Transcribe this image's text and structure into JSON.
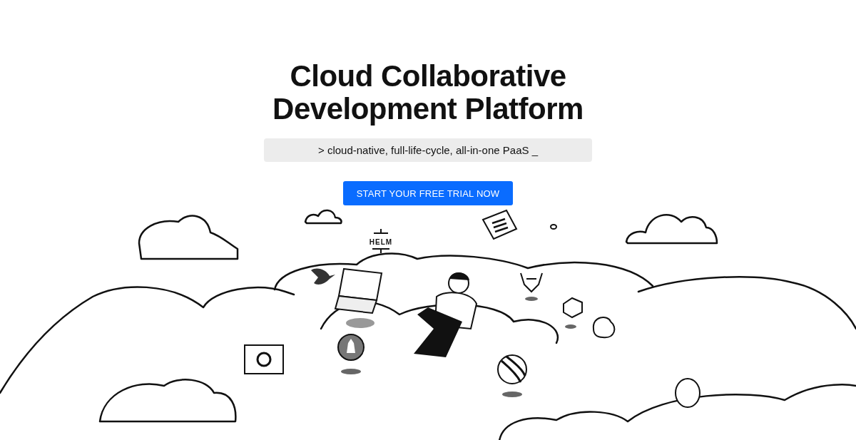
{
  "hero": {
    "title": "Cloud Collaborative Development Platform",
    "tagline": "> cloud-native, full-life-cycle, all-in-one PaaS _",
    "cta_button": "START YOUR FREE TRIAL NOW"
  },
  "illustration": {
    "logo_label": "HELM"
  }
}
